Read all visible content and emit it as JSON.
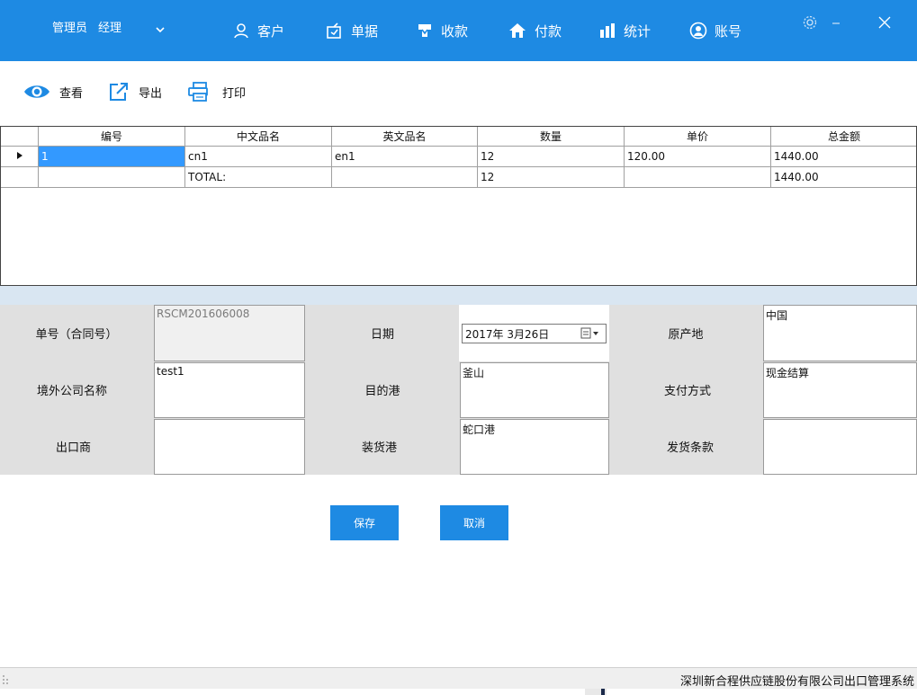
{
  "header": {
    "user_role": "管理员",
    "user_name": "经理",
    "nav": [
      {
        "label": "客户",
        "icon": "user-icon"
      },
      {
        "label": "单据",
        "icon": "document-icon"
      },
      {
        "label": "收款",
        "icon": "download-icon"
      },
      {
        "label": "付款",
        "icon": "home-icon"
      },
      {
        "label": "统计",
        "icon": "bar-chart-icon"
      },
      {
        "label": "账号",
        "icon": "account-icon"
      }
    ],
    "accent": "#1e8ae3"
  },
  "toolbar": {
    "view_label": "查看",
    "export_label": "导出",
    "print_label": "打印"
  },
  "grid": {
    "columns": [
      "编号",
      "中文品名",
      "英文品名",
      "数量",
      "单价",
      "总金额"
    ],
    "rows": [
      [
        "1",
        "cn1",
        "en1",
        "12",
        "120.00",
        "1440.00"
      ],
      [
        "",
        "TOTAL:",
        "",
        "12",
        "",
        "1440.00"
      ]
    ]
  },
  "form": {
    "contract_no_label": "单号（合同号）",
    "contract_no_value": "RSCM201606008",
    "date_label": "日期",
    "date_value": "2017年  3月26日",
    "origin_label": "原产地",
    "origin_value": "中国",
    "foreign_company_label": "境外公司名称",
    "foreign_company_value": "test1",
    "destination_port_label": "目的港",
    "destination_port_value": "釜山",
    "payment_method_label": "支付方式",
    "payment_method_value": "现金结算",
    "exporter_label": "出口商",
    "exporter_value": "",
    "loading_port_label": "装货港",
    "loading_port_value": "蛇口港",
    "shipping_terms_label": "发货条款",
    "shipping_terms_value": ""
  },
  "actions": {
    "save_label": "保存",
    "cancel_label": "取消"
  },
  "status": {
    "text": "深圳新合程供应链股份有限公司出口管理系统"
  }
}
